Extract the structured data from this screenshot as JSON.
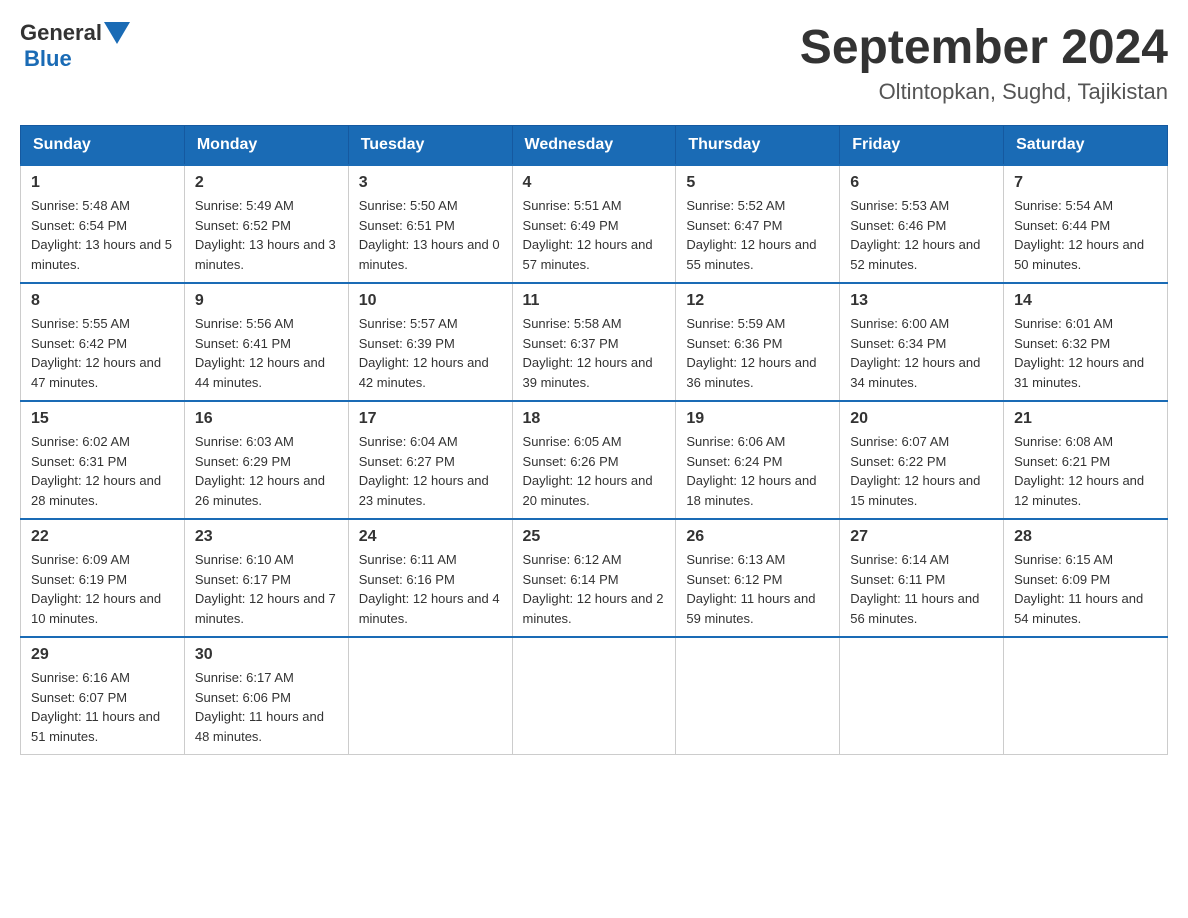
{
  "header": {
    "logo_general": "General",
    "logo_blue": "Blue",
    "month_year": "September 2024",
    "location": "Oltintopkan, Sughd, Tajikistan"
  },
  "days_of_week": [
    "Sunday",
    "Monday",
    "Tuesday",
    "Wednesday",
    "Thursday",
    "Friday",
    "Saturday"
  ],
  "weeks": [
    [
      {
        "day": "1",
        "sunrise": "5:48 AM",
        "sunset": "6:54 PM",
        "daylight": "13 hours and 5 minutes."
      },
      {
        "day": "2",
        "sunrise": "5:49 AM",
        "sunset": "6:52 PM",
        "daylight": "13 hours and 3 minutes."
      },
      {
        "day": "3",
        "sunrise": "5:50 AM",
        "sunset": "6:51 PM",
        "daylight": "13 hours and 0 minutes."
      },
      {
        "day": "4",
        "sunrise": "5:51 AM",
        "sunset": "6:49 PM",
        "daylight": "12 hours and 57 minutes."
      },
      {
        "day": "5",
        "sunrise": "5:52 AM",
        "sunset": "6:47 PM",
        "daylight": "12 hours and 55 minutes."
      },
      {
        "day": "6",
        "sunrise": "5:53 AM",
        "sunset": "6:46 PM",
        "daylight": "12 hours and 52 minutes."
      },
      {
        "day": "7",
        "sunrise": "5:54 AM",
        "sunset": "6:44 PM",
        "daylight": "12 hours and 50 minutes."
      }
    ],
    [
      {
        "day": "8",
        "sunrise": "5:55 AM",
        "sunset": "6:42 PM",
        "daylight": "12 hours and 47 minutes."
      },
      {
        "day": "9",
        "sunrise": "5:56 AM",
        "sunset": "6:41 PM",
        "daylight": "12 hours and 44 minutes."
      },
      {
        "day": "10",
        "sunrise": "5:57 AM",
        "sunset": "6:39 PM",
        "daylight": "12 hours and 42 minutes."
      },
      {
        "day": "11",
        "sunrise": "5:58 AM",
        "sunset": "6:37 PM",
        "daylight": "12 hours and 39 minutes."
      },
      {
        "day": "12",
        "sunrise": "5:59 AM",
        "sunset": "6:36 PM",
        "daylight": "12 hours and 36 minutes."
      },
      {
        "day": "13",
        "sunrise": "6:00 AM",
        "sunset": "6:34 PM",
        "daylight": "12 hours and 34 minutes."
      },
      {
        "day": "14",
        "sunrise": "6:01 AM",
        "sunset": "6:32 PM",
        "daylight": "12 hours and 31 minutes."
      }
    ],
    [
      {
        "day": "15",
        "sunrise": "6:02 AM",
        "sunset": "6:31 PM",
        "daylight": "12 hours and 28 minutes."
      },
      {
        "day": "16",
        "sunrise": "6:03 AM",
        "sunset": "6:29 PM",
        "daylight": "12 hours and 26 minutes."
      },
      {
        "day": "17",
        "sunrise": "6:04 AM",
        "sunset": "6:27 PM",
        "daylight": "12 hours and 23 minutes."
      },
      {
        "day": "18",
        "sunrise": "6:05 AM",
        "sunset": "6:26 PM",
        "daylight": "12 hours and 20 minutes."
      },
      {
        "day": "19",
        "sunrise": "6:06 AM",
        "sunset": "6:24 PM",
        "daylight": "12 hours and 18 minutes."
      },
      {
        "day": "20",
        "sunrise": "6:07 AM",
        "sunset": "6:22 PM",
        "daylight": "12 hours and 15 minutes."
      },
      {
        "day": "21",
        "sunrise": "6:08 AM",
        "sunset": "6:21 PM",
        "daylight": "12 hours and 12 minutes."
      }
    ],
    [
      {
        "day": "22",
        "sunrise": "6:09 AM",
        "sunset": "6:19 PM",
        "daylight": "12 hours and 10 minutes."
      },
      {
        "day": "23",
        "sunrise": "6:10 AM",
        "sunset": "6:17 PM",
        "daylight": "12 hours and 7 minutes."
      },
      {
        "day": "24",
        "sunrise": "6:11 AM",
        "sunset": "6:16 PM",
        "daylight": "12 hours and 4 minutes."
      },
      {
        "day": "25",
        "sunrise": "6:12 AM",
        "sunset": "6:14 PM",
        "daylight": "12 hours and 2 minutes."
      },
      {
        "day": "26",
        "sunrise": "6:13 AM",
        "sunset": "6:12 PM",
        "daylight": "11 hours and 59 minutes."
      },
      {
        "day": "27",
        "sunrise": "6:14 AM",
        "sunset": "6:11 PM",
        "daylight": "11 hours and 56 minutes."
      },
      {
        "day": "28",
        "sunrise": "6:15 AM",
        "sunset": "6:09 PM",
        "daylight": "11 hours and 54 minutes."
      }
    ],
    [
      {
        "day": "29",
        "sunrise": "6:16 AM",
        "sunset": "6:07 PM",
        "daylight": "11 hours and 51 minutes."
      },
      {
        "day": "30",
        "sunrise": "6:17 AM",
        "sunset": "6:06 PM",
        "daylight": "11 hours and 48 minutes."
      },
      null,
      null,
      null,
      null,
      null
    ]
  ]
}
